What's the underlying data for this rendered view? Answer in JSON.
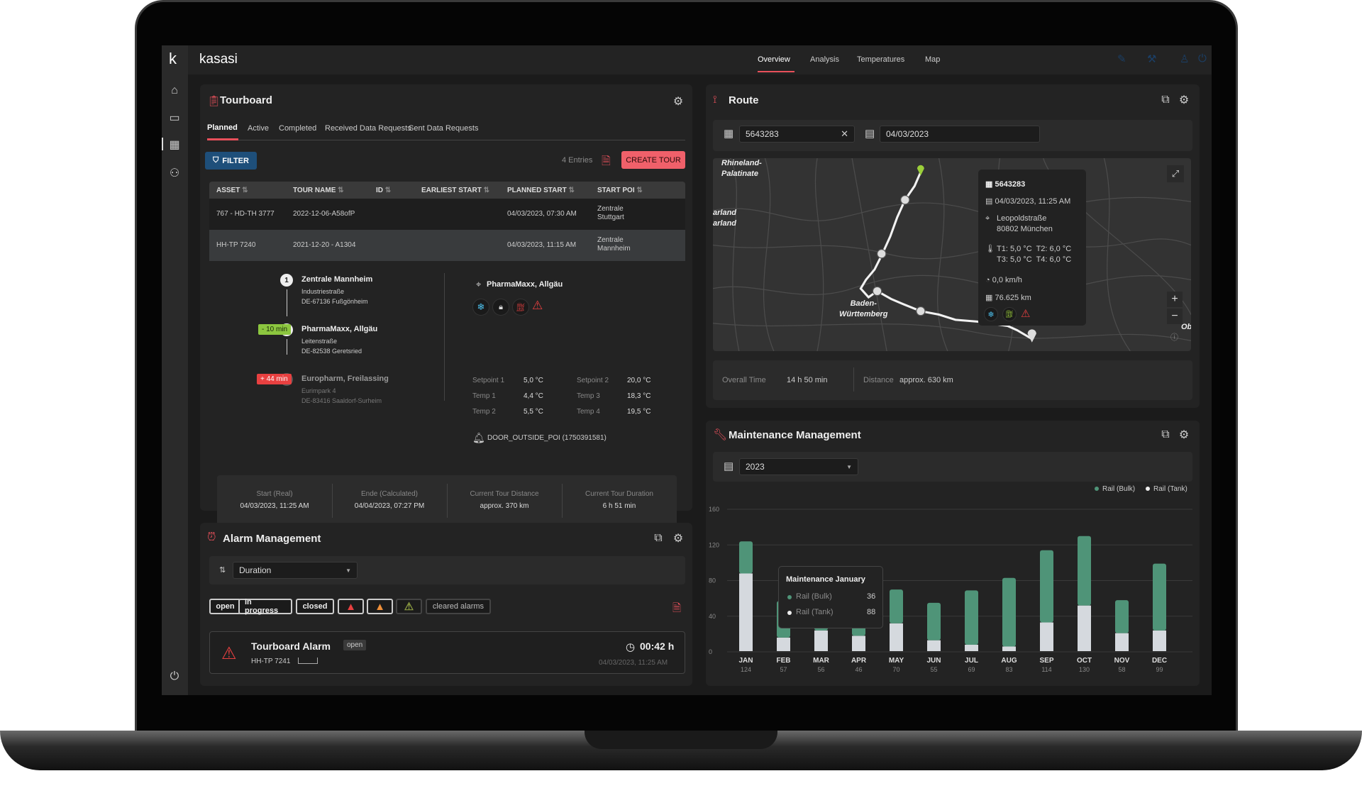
{
  "header": {
    "logo": "k",
    "brand": "kasasi",
    "nav": [
      {
        "label": "Overview",
        "active": true
      },
      {
        "label": "Analysis"
      },
      {
        "label": "Temperatures"
      },
      {
        "label": "Map"
      }
    ]
  },
  "colors": {
    "accent": "#e8505b",
    "filter": "#1e4f7a",
    "create": "#f0606a",
    "bulk": "#4f9478",
    "tank": "#d5d9de",
    "early": "#8cc63f",
    "late": "#e84040"
  },
  "tourboard": {
    "title": "Tourboard",
    "tabs": [
      "Planned",
      "Active",
      "Completed",
      "Received Data Requests",
      "Sent Data Requests"
    ],
    "filter_label": "FILTER",
    "entries": "4 Entries",
    "create_label": "CREATE TOUR",
    "columns": [
      "ASSET",
      "TOUR NAME",
      "ID",
      "EARLIEST START",
      "PLANNED START",
      "START POI"
    ],
    "rows": [
      [
        "767 - HD-TH 3777",
        "2022-12-06-A58ofP",
        "",
        "",
        "04/03/2023, 07:30 AM",
        "Zentrale Stuttgart"
      ],
      [
        "HH-TP 7240",
        "2021-12-20 - A1304",
        "",
        "",
        "04/03/2023, 11:15 AM",
        "Zentrale Mannheim"
      ]
    ],
    "stops": [
      {
        "n": "1",
        "name": "Zentrale Mannheim",
        "street": "Industriestraße",
        "city": "DE-67136 Fußgönheim",
        "badge": ""
      },
      {
        "n": "2",
        "name": "PharmaMaxx, Allgäu",
        "street": "Leitenstraße",
        "city": "DE-82538 Geretsried",
        "badge": "- 10 min"
      },
      {
        "n": "3",
        "name": "Europharm, Freilassing",
        "street": "Eurimpark 4",
        "city": "DE-83416 Saaldorf-Surheim",
        "badge": "+ 44 min"
      }
    ],
    "poi": "PharmaMaxx, Allgäu",
    "temps": [
      [
        "Setpoint 1",
        "5,0 °C",
        "Setpoint 2",
        "20,0 °C"
      ],
      [
        "Temp 1",
        "4,4 °C",
        "Temp 3",
        "18,3 °C"
      ],
      [
        "Temp 2",
        "5,5 °C",
        "Temp 4",
        "19,5 °C"
      ]
    ],
    "door": "DOOR_OUTSIDE_POI (1750391581)",
    "summary": [
      [
        "Start (Real)",
        "04/03/2023, 11:25 AM"
      ],
      [
        "Ende (Calculated)",
        "04/04/2023, 07:27 PM"
      ],
      [
        "Current Tour Distance",
        "approx. 370 km"
      ],
      [
        "Current Tour Duration",
        "6 h 51 min"
      ]
    ]
  },
  "alarm": {
    "title": "Alarm Management",
    "sort": "Duration",
    "chips": [
      "open",
      "in progress",
      "closed"
    ],
    "cleared": "cleared alarms",
    "item": {
      "title": "Tourboard Alarm",
      "status": "open",
      "asset": "HH-TP 7241",
      "duration": "00:42 h",
      "time": "04/03/2023, 11:25 AM"
    }
  },
  "route": {
    "title": "Route",
    "search": "5643283",
    "date": "04/03/2023",
    "map_labels": [
      "Rhineland-",
      "Palatinate",
      "arland",
      "arland",
      "Baden-",
      "Württemberg",
      "Ob"
    ],
    "tooltip": {
      "id": "5643283",
      "time": "04/03/2023, 11:25 AM",
      "street": "Leopoldstraße",
      "city": "80802 München",
      "t1": "T1: 5,0 °C",
      "t2": "T2: 6,0 °C",
      "t3": "T3: 5,0 °C",
      "t4": "T4: 6,0 °C",
      "speed": "0,0 km/h",
      "odo": "76.625 km"
    },
    "overall_label": "Overall Time",
    "overall": "14 h 50 min",
    "distance_label": "Distance",
    "distance": "approx. 630 km"
  },
  "maintenance": {
    "title": "Maintenance Management",
    "year": "2023",
    "tooltip": {
      "title": "Maintenance January",
      "bulk": "36",
      "tank": "88"
    }
  },
  "chart_data": {
    "type": "bar",
    "stacked": true,
    "categories": [
      "JAN",
      "FEB",
      "MAR",
      "APR",
      "MAY",
      "JUN",
      "JUL",
      "AUG",
      "SEP",
      "OCT",
      "NOV",
      "DEC"
    ],
    "totals": [
      124,
      57,
      56,
      46,
      70,
      55,
      69,
      83,
      114,
      130,
      58,
      99
    ],
    "series": [
      {
        "name": "Rail (Bulk)",
        "color": "#4f9478",
        "values": [
          36,
          41,
          32,
          28,
          38,
          42,
          61,
          77,
          81,
          78,
          37,
          75
        ]
      },
      {
        "name": "Rail (Tank)",
        "color": "#d5d9de",
        "values": [
          88,
          16,
          24,
          18,
          32,
          13,
          8,
          6,
          33,
          52,
          21,
          24
        ]
      }
    ],
    "ylim": [
      0,
      160
    ],
    "yticks": [
      0,
      40,
      80,
      120,
      160
    ],
    "grid": true,
    "legend": "top-right"
  }
}
